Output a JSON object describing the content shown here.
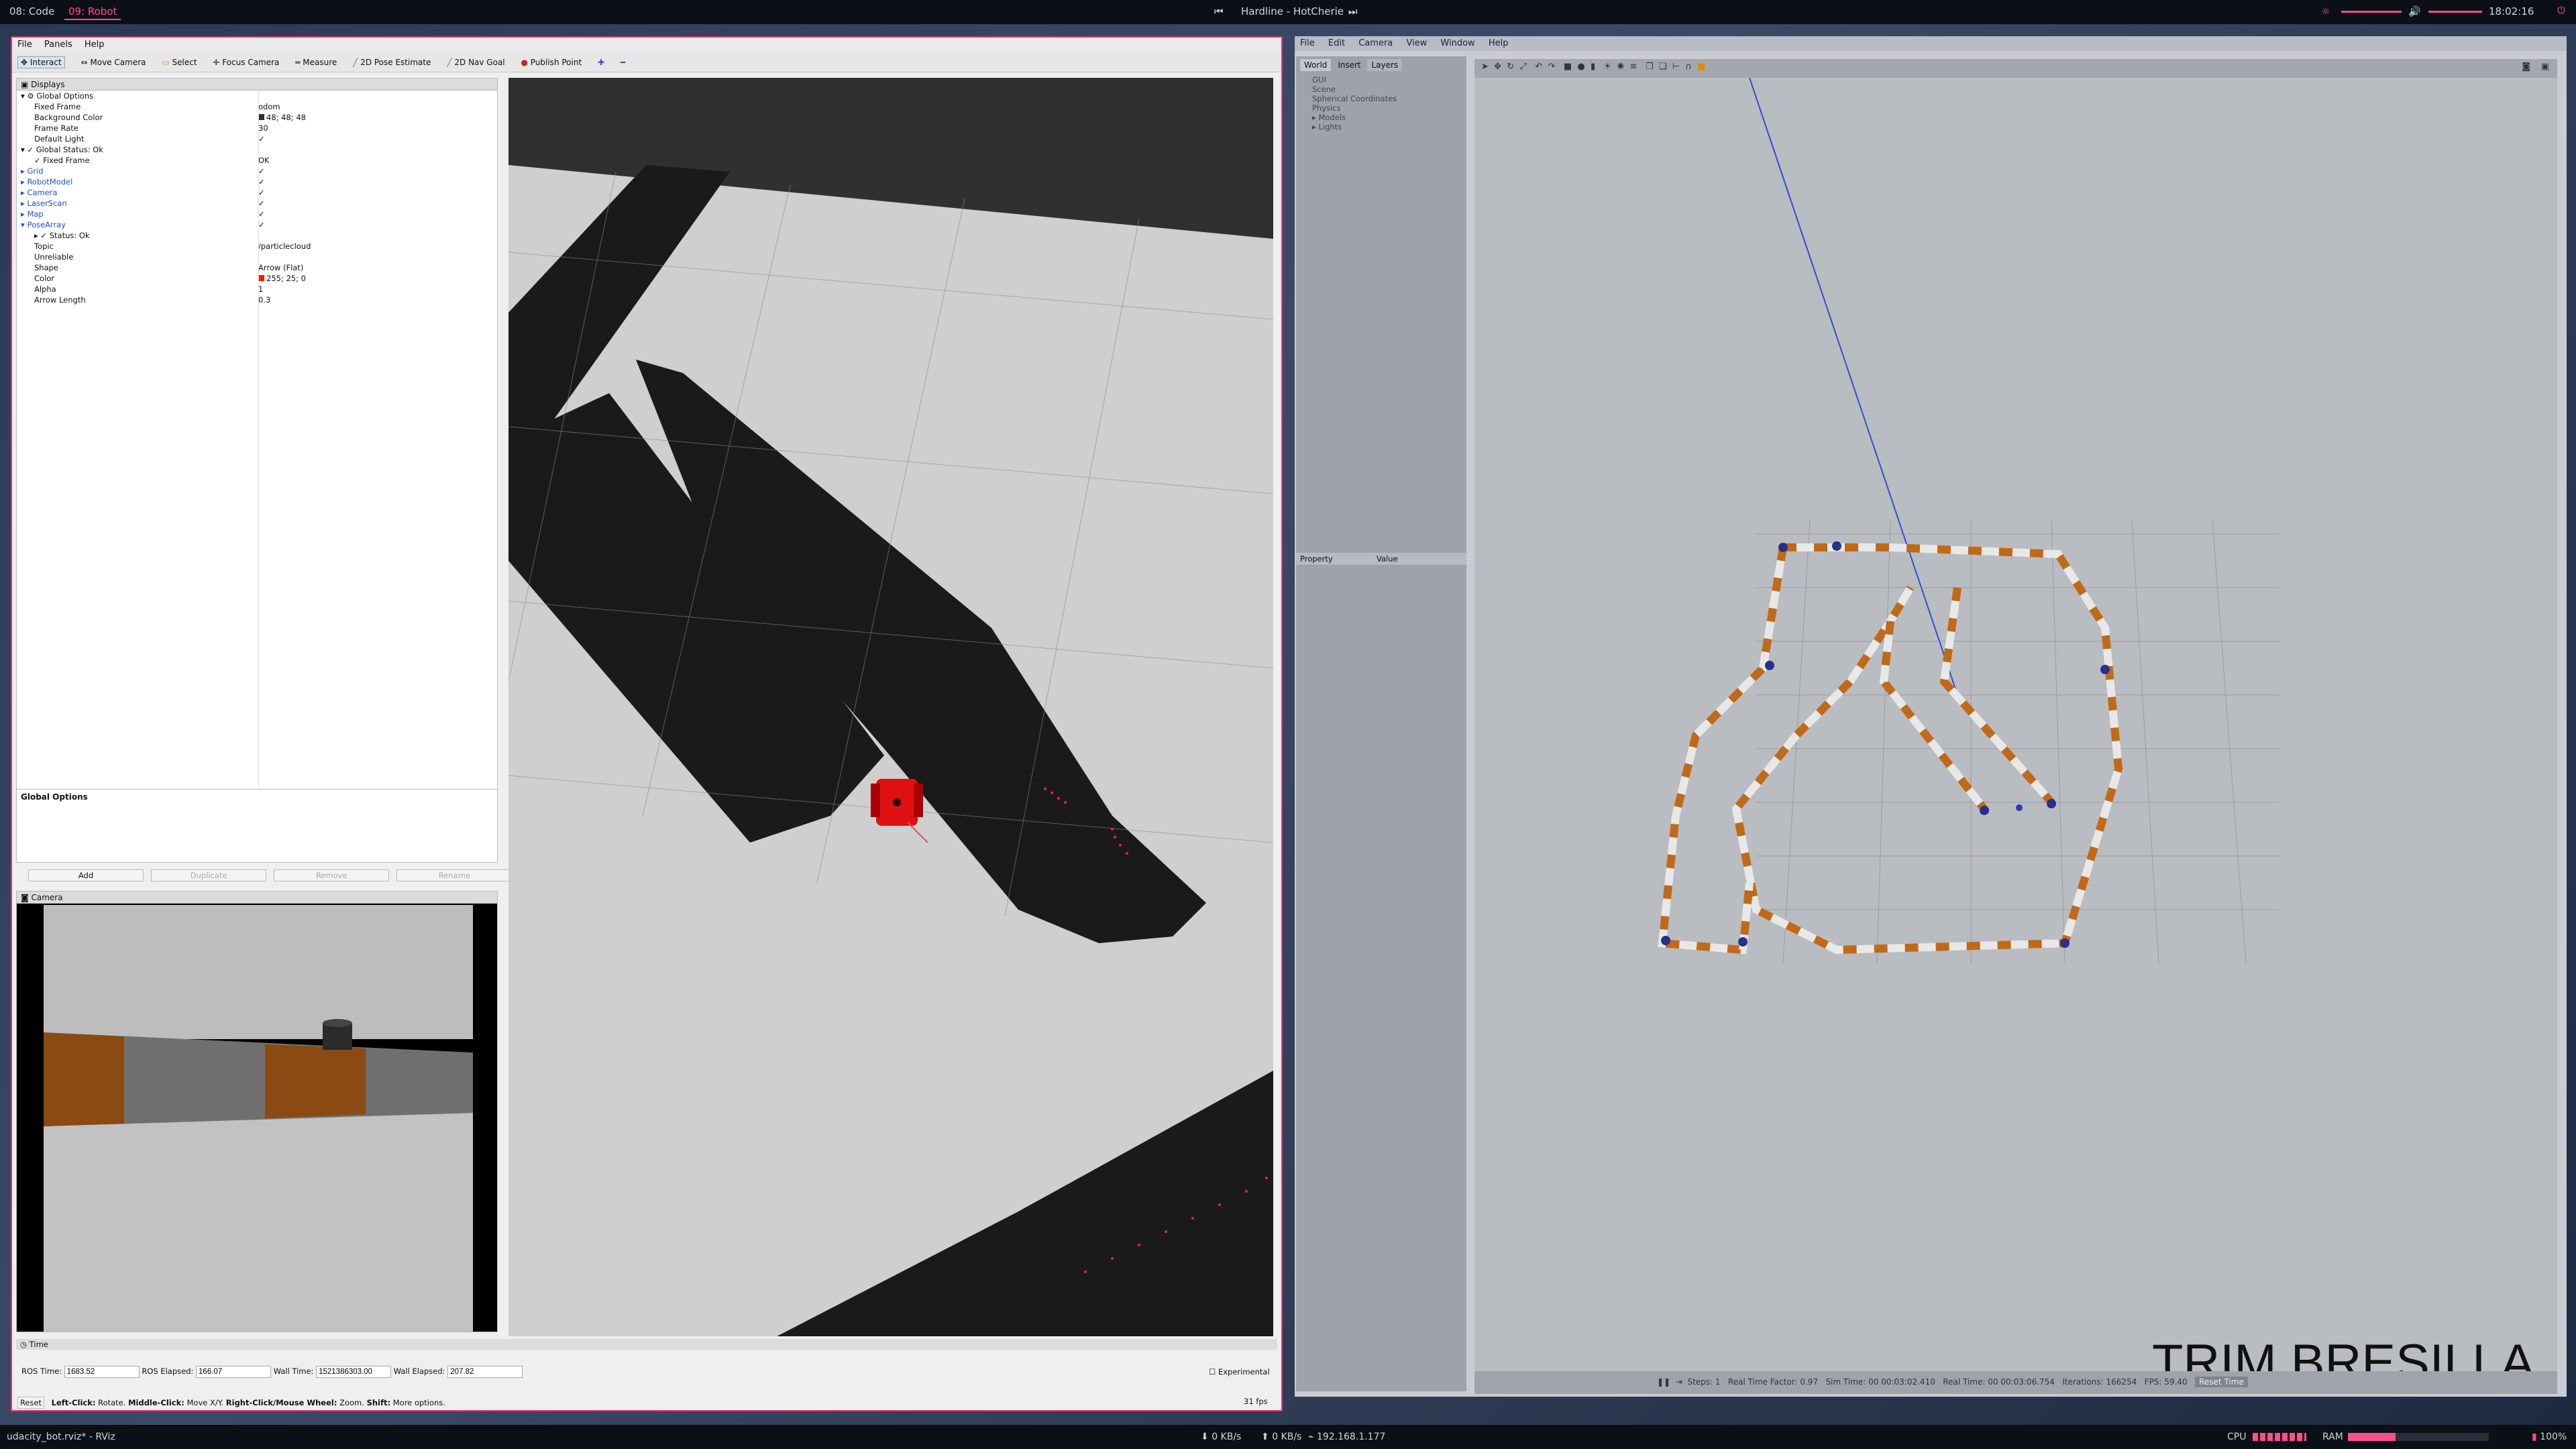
{
  "topbar": {
    "workspaces": [
      "08: Code",
      "09: Robot"
    ],
    "active_workspace": "09: Robot",
    "now_playing": "Hardline - HotCherie",
    "clock": "18:02:16"
  },
  "bottombar": {
    "window_title": "udacity_bot.rviz* - RViz",
    "down_rate": "0 KB/s",
    "up_rate": "0 KB/s",
    "ip": "192.168.1.177",
    "cpu_label": "CPU",
    "ram_label": "RAM",
    "battery": "100%"
  },
  "rviz": {
    "menu": [
      "File",
      "Panels",
      "Help"
    ],
    "toolbar": [
      "Interact",
      "Move Camera",
      "Select",
      "Focus Camera",
      "Measure",
      "2D Pose Estimate",
      "2D Nav Goal",
      "Publish Point"
    ],
    "displays_title": "Displays",
    "tree": [
      {
        "label": "Global Options",
        "value": "",
        "indent": 1,
        "arrow": "▾",
        "icon": "gear"
      },
      {
        "label": "Fixed Frame",
        "value": "odom",
        "indent": 2
      },
      {
        "label": "Background Color",
        "value": "48; 48; 48",
        "indent": 2,
        "swatch": "#303030"
      },
      {
        "label": "Frame Rate",
        "value": "30",
        "indent": 2
      },
      {
        "label": "Default Light",
        "value": "✓",
        "indent": 2
      },
      {
        "label": "Global Status: Ok",
        "value": "",
        "indent": 1,
        "arrow": "▾",
        "icon": "check"
      },
      {
        "label": "Fixed Frame",
        "value": "OK",
        "indent": 2,
        "icon": "check"
      },
      {
        "label": "Grid",
        "value": "✓",
        "indent": 1,
        "arrow": "▸",
        "blue": true
      },
      {
        "label": "RobotModel",
        "value": "✓",
        "indent": 1,
        "arrow": "▸",
        "blue": true
      },
      {
        "label": "Camera",
        "value": "✓",
        "indent": 1,
        "arrow": "▸",
        "blue": true
      },
      {
        "label": "LaserScan",
        "value": "✓",
        "indent": 1,
        "arrow": "▸",
        "blue": true
      },
      {
        "label": "Map",
        "value": "✓",
        "indent": 1,
        "arrow": "▸",
        "blue": true
      },
      {
        "label": "PoseArray",
        "value": "✓",
        "indent": 1,
        "arrow": "▾",
        "blue": true
      },
      {
        "label": "Status: Ok",
        "value": "",
        "indent": 2,
        "arrow": "▸",
        "icon": "check"
      },
      {
        "label": "Topic",
        "value": "/particlecloud",
        "indent": 2
      },
      {
        "label": "Unreliable",
        "value": "",
        "indent": 2
      },
      {
        "label": "Shape",
        "value": "Arrow (Flat)",
        "indent": 2
      },
      {
        "label": "Color",
        "value": "255; 25; 0",
        "indent": 2,
        "swatch": "#ff1900"
      },
      {
        "label": "Alpha",
        "value": "1",
        "indent": 2
      },
      {
        "label": "Arrow Length",
        "value": "0.3",
        "indent": 2
      }
    ],
    "desc_title": "Global Options",
    "buttons": {
      "add": "Add",
      "duplicate": "Duplicate",
      "remove": "Remove",
      "rename": "Rename"
    },
    "camera_title": "Camera",
    "time_title": "Time",
    "ros_time_label": "ROS Time:",
    "ros_time": "1683.52",
    "ros_elapsed_label": "ROS Elapsed:",
    "ros_elapsed": "166.07",
    "wall_time_label": "Wall Time:",
    "wall_time": "1521386303.00",
    "wall_elapsed_label": "Wall Elapsed:",
    "wall_elapsed": "207.82",
    "experimental": "Experimental",
    "reset": "Reset",
    "hint_1": "Left-Click:",
    "hint_2": " Rotate. ",
    "hint_3": "Middle-Click:",
    "hint_4": " Move X/Y. ",
    "hint_5": "Right-Click/Mouse Wheel:",
    "hint_6": " Zoom. ",
    "hint_7": "Shift:",
    "hint_8": " More options.",
    "fps": "31 fps"
  },
  "gazebo": {
    "menu": [
      "File",
      "Edit",
      "Camera",
      "View",
      "Window",
      "Help"
    ],
    "tabs": [
      "World",
      "Insert",
      "Layers"
    ],
    "world_items": [
      "GUI",
      "Scene",
      "Spherical Coordinates",
      "Physics",
      "Models",
      "Lights"
    ],
    "prop_header": [
      "Property",
      "Value"
    ],
    "status": {
      "steps_label": "Steps:",
      "steps": "1",
      "rtf_label": "Real Time Factor:",
      "rtf": "0.97",
      "sim_label": "Sim Time:",
      "sim": "00 00:03:02.410",
      "real_label": "Real Time:",
      "real": "00 00:03:06.754",
      "iter_label": "Iterations:",
      "iter": "166254",
      "fps_label": "FPS:",
      "fps": "59.40",
      "reset": "Reset Time"
    },
    "watermark": "TRIM BRESILLA"
  }
}
